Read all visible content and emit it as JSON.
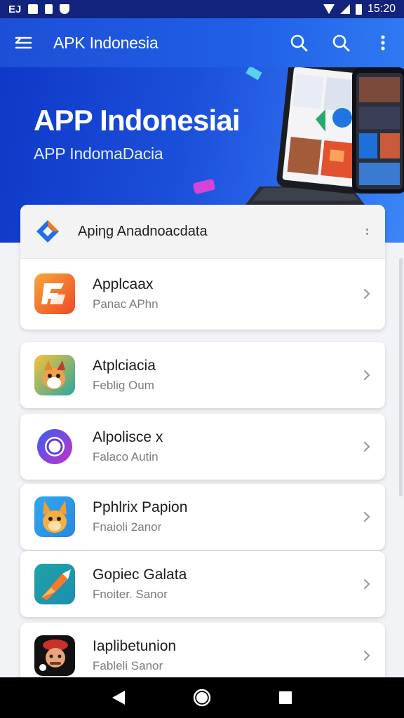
{
  "status_bar": {
    "left_label": "EJ",
    "time": "15:20"
  },
  "app_bar": {
    "title": "APK Indonesia",
    "icons": [
      "menu-icon",
      "search-icon",
      "search-icon",
      "more-vert-icon"
    ]
  },
  "hero": {
    "title": "APP Indonesiai",
    "subtitle": "APP IndomaDacia"
  },
  "main_card": {
    "title": "Apiηg Anadnoacdata",
    "icon": "diamond-logo-icon"
  },
  "apps": [
    {
      "title": "Applcaax",
      "subtitle": "Panac APhn",
      "icon": "orange-app-icon"
    },
    {
      "title": "Atplciacia",
      "subtitle": "Feblig Oum",
      "icon": "fox-app-icon"
    },
    {
      "title": "Alpolisce x",
      "subtitle": "Falaco Autin",
      "icon": "ring-app-icon"
    },
    {
      "title": "Pphlrix Papion",
      "subtitle": "Fnaioli 2anor",
      "icon": "kangaroo-app-icon"
    },
    {
      "title": "Gopiec Galata",
      "subtitle": "Fnoiter. Sanor",
      "icon": "play-arrow-app-icon"
    },
    {
      "title": "Iaplibetunion",
      "subtitle": "Fableli Sanor",
      "icon": "character-app-icon"
    }
  ],
  "colors": {
    "status_bar": "#11237a",
    "app_bar": "#1f5fe6",
    "hero": "#1b4fd9",
    "background": "#f2f3f6"
  }
}
